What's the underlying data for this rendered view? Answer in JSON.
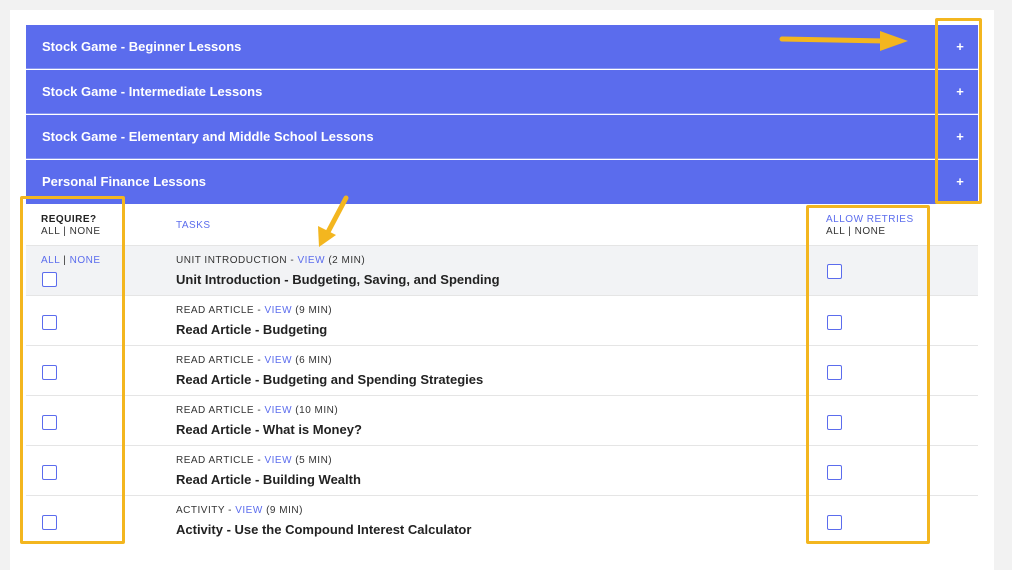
{
  "accordions": [
    {
      "title": "Stock Game - Beginner Lessons",
      "toggle": "+"
    },
    {
      "title": "Stock Game - Intermediate Lessons",
      "toggle": "+"
    },
    {
      "title": "Stock Game - Elementary and Middle School Lessons",
      "toggle": "+"
    },
    {
      "title": "Personal Finance Lessons",
      "toggle": "+"
    }
  ],
  "header": {
    "require_label": "REQUIRE?",
    "all": "ALL",
    "sep": "|",
    "none": "NONE",
    "tasks_label": "TASKS",
    "allow_retries_label": "ALLOW RETRIES"
  },
  "row_select": {
    "all": "ALL",
    "sep": "|",
    "none": "NONE"
  },
  "tasks": [
    {
      "type": "UNIT INTRODUCTION",
      "view": "VIEW",
      "duration": "(2 MIN)",
      "title": "Unit Introduction - Budgeting, Saving, and Spending"
    },
    {
      "type": "READ ARTICLE",
      "view": "VIEW",
      "duration": "(9 MIN)",
      "title": "Read Article - Budgeting"
    },
    {
      "type": "READ ARTICLE",
      "view": "VIEW",
      "duration": "(6 MIN)",
      "title": "Read Article - Budgeting and Spending Strategies"
    },
    {
      "type": "READ ARTICLE",
      "view": "VIEW",
      "duration": "(10 MIN)",
      "title": "Read Article - What is Money?"
    },
    {
      "type": "READ ARTICLE",
      "view": "VIEW",
      "duration": "(5 MIN)",
      "title": "Read Article - Building Wealth"
    },
    {
      "type": "ACTIVITY",
      "view": "VIEW",
      "duration": "(9 MIN)",
      "title": "Activity - Use the Compound Interest Calculator"
    }
  ],
  "colors": {
    "accent": "#5b6ced",
    "highlight": "#f3b61f"
  }
}
